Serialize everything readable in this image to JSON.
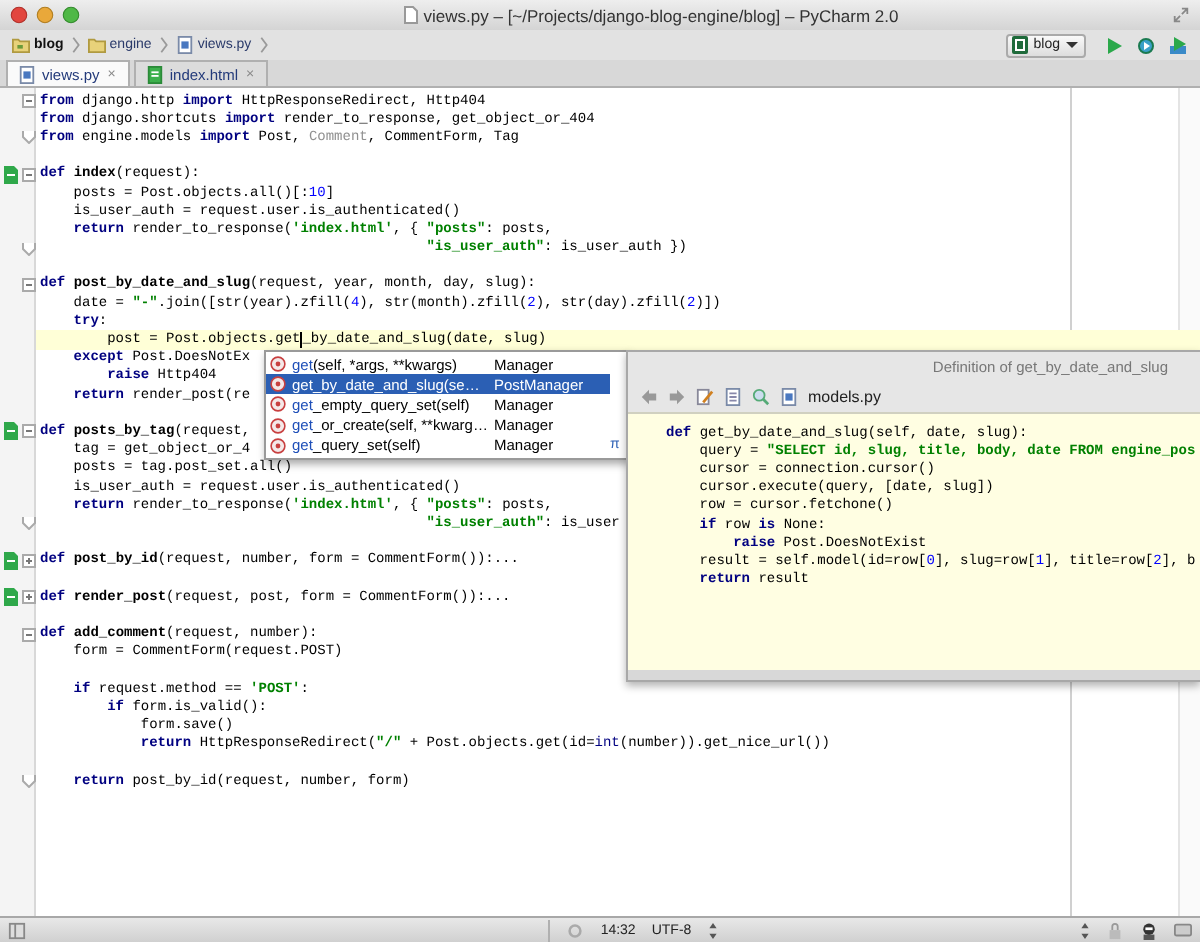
{
  "window": {
    "title": "views.py – [~/Projects/django-blog-engine/blog] – PyCharm 2.0"
  },
  "breadcrumbs": [
    {
      "label": "blog",
      "kind": "project"
    },
    {
      "label": "engine",
      "kind": "folder"
    },
    {
      "label": "views.py",
      "kind": "python"
    }
  ],
  "run_config": {
    "label": "blog"
  },
  "tabs": [
    {
      "label": "views.py",
      "kind": "python",
      "selected": true,
      "close": "×"
    },
    {
      "label": "index.html",
      "kind": "html",
      "selected": false,
      "close": "×"
    }
  ],
  "lines": [
    {
      "markers": [
        {
          "kind": "fold_open"
        }
      ],
      "tokens": [
        {
          "kind": "kw",
          "text": "from"
        },
        {
          "kind": "plain",
          "text": " django.http "
        },
        {
          "kind": "kw",
          "text": "import"
        },
        {
          "kind": "plain",
          "text": " HttpResponseRedirect, Http404"
        }
      ]
    },
    {
      "tokens": [
        {
          "kind": "kw",
          "text": "from"
        },
        {
          "kind": "plain",
          "text": " django.shortcuts "
        },
        {
          "kind": "kw",
          "text": "import"
        },
        {
          "kind": "plain",
          "text": " render_to_response, get_object_or_404"
        }
      ]
    },
    {
      "blank_after": true,
      "markers": [
        {
          "kind": "fold_end"
        }
      ],
      "tokens": [
        {
          "kind": "kw",
          "text": "from"
        },
        {
          "kind": "plain",
          "text": " engine.models "
        },
        {
          "kind": "kw",
          "text": "import"
        },
        {
          "kind": "plain",
          "text": " Post, "
        },
        {
          "kind": "unused",
          "text": "Comment"
        },
        {
          "kind": "plain",
          "text": ", CommentForm, Tag"
        }
      ]
    },
    {
      "markers": [
        {
          "kind": "file"
        },
        {
          "kind": "fold_open"
        }
      ],
      "tokens": [
        {
          "kind": "kw",
          "text": "def "
        },
        {
          "kind": "fn",
          "text": "index"
        },
        {
          "kind": "plain",
          "text": "(request):"
        }
      ]
    },
    {
      "tokens": [
        {
          "kind": "plain",
          "text": "    posts = Post.objects.all()[:"
        },
        {
          "kind": "num",
          "text": "10"
        },
        {
          "kind": "plain",
          "text": "]"
        }
      ]
    },
    {
      "tokens": [
        {
          "kind": "plain",
          "text": "    is_user_auth = request.user.is_authenticated()"
        }
      ]
    },
    {
      "tokens": [
        {
          "kind": "kw",
          "text": "    return"
        },
        {
          "kind": "plain",
          "text": " render_to_response("
        },
        {
          "kind": "str",
          "text": "'index.html'"
        },
        {
          "kind": "plain",
          "text": ", { "
        },
        {
          "kind": "str",
          "text": "\"posts\""
        },
        {
          "kind": "plain",
          "text": ": posts,"
        }
      ]
    },
    {
      "blank_after": true,
      "markers": [
        {
          "kind": "fold_end"
        }
      ],
      "tokens": [
        {
          "kind": "str",
          "text": "                                              \"is_user_auth\""
        },
        {
          "kind": "plain",
          "text": ": is_user_auth })"
        }
      ]
    },
    {
      "markers": [
        {
          "kind": "fold_open"
        }
      ],
      "tokens": [
        {
          "kind": "kw",
          "text": "def "
        },
        {
          "kind": "fn",
          "text": "post_by_date_and_slug"
        },
        {
          "kind": "plain",
          "text": "(request, year, month, day, slug):"
        }
      ]
    },
    {
      "tokens": [
        {
          "kind": "plain",
          "text": "    date = "
        },
        {
          "kind": "str",
          "text": "\"-\""
        },
        {
          "kind": "plain",
          "text": ".join([str(year).zfill("
        },
        {
          "kind": "num",
          "text": "4"
        },
        {
          "kind": "plain",
          "text": "), str(month).zfill("
        },
        {
          "kind": "num",
          "text": "2"
        },
        {
          "kind": "plain",
          "text": "), str(day).zfill("
        },
        {
          "kind": "num",
          "text": "2"
        },
        {
          "kind": "plain",
          "text": ")])"
        }
      ]
    },
    {
      "tokens": [
        {
          "kind": "kw",
          "text": "    try"
        },
        {
          "kind": "plain",
          "text": ":"
        }
      ]
    },
    {
      "current": true,
      "tokens": [
        {
          "kind": "plain",
          "text": "        post = Post.objects.get"
        },
        {
          "kind": "caret"
        },
        {
          "kind": "plain",
          "text": "_by_date_and_slug(date, slug)"
        }
      ]
    },
    {
      "tokens": [
        {
          "kind": "kw",
          "text": "    except"
        },
        {
          "kind": "plain",
          "text": " Post.DoesNotEx"
        }
      ]
    },
    {
      "tokens": [
        {
          "kind": "kw",
          "text": "        raise"
        },
        {
          "kind": "plain",
          "text": " Http404"
        }
      ]
    },
    {
      "blank_after": true,
      "tokens": [
        {
          "kind": "kw",
          "text": "    return"
        },
        {
          "kind": "plain",
          "text": " render_post(re"
        }
      ]
    },
    {
      "markers": [
        {
          "kind": "file"
        },
        {
          "kind": "fold_open"
        }
      ],
      "tokens": [
        {
          "kind": "kw",
          "text": "def "
        },
        {
          "kind": "fn",
          "text": "posts_by_tag"
        },
        {
          "kind": "plain",
          "text": "(request,"
        }
      ]
    },
    {
      "tokens": [
        {
          "kind": "plain",
          "text": "    tag = get_object_or_4"
        }
      ]
    },
    {
      "tokens": [
        {
          "kind": "plain",
          "text": "    posts = tag.post_set.all()"
        }
      ]
    },
    {
      "tokens": [
        {
          "kind": "plain",
          "text": "    is_user_auth = request.user.is_authenticated()"
        }
      ]
    },
    {
      "tokens": [
        {
          "kind": "kw",
          "text": "    return"
        },
        {
          "kind": "plain",
          "text": " render_to_response("
        },
        {
          "kind": "str",
          "text": "'index.html'"
        },
        {
          "kind": "plain",
          "text": ", { "
        },
        {
          "kind": "str",
          "text": "\"posts\""
        },
        {
          "kind": "plain",
          "text": ": posts,"
        }
      ]
    },
    {
      "blank_after": true,
      "markers": [
        {
          "kind": "fold_end"
        }
      ],
      "tokens": [
        {
          "kind": "str",
          "text": "                                              \"is_user_auth\""
        },
        {
          "kind": "plain",
          "text": ": is_user"
        }
      ]
    },
    {
      "blank_after": true,
      "markers": [
        {
          "kind": "file"
        },
        {
          "kind": "fold_closed"
        }
      ],
      "tokens": [
        {
          "kind": "kw",
          "text": "def "
        },
        {
          "kind": "fn",
          "text": "post_by_id"
        },
        {
          "kind": "plain",
          "text": "(request, number, form = CommentForm()):..."
        }
      ]
    },
    {
      "blank_after": true,
      "markers": [
        {
          "kind": "file"
        },
        {
          "kind": "fold_closed"
        }
      ],
      "tokens": [
        {
          "kind": "kw",
          "text": "def "
        },
        {
          "kind": "fn",
          "text": "render_post"
        },
        {
          "kind": "plain",
          "text": "(request, post, form = CommentForm()):..."
        }
      ]
    },
    {
      "markers": [
        {
          "kind": "fold_open"
        }
      ],
      "tokens": [
        {
          "kind": "kw",
          "text": "def "
        },
        {
          "kind": "fn",
          "text": "add_comment"
        },
        {
          "kind": "plain",
          "text": "(request, number):"
        }
      ]
    },
    {
      "blank_after": true,
      "tokens": [
        {
          "kind": "plain",
          "text": "    form = CommentForm(request.POST)"
        }
      ]
    },
    {
      "tokens": [
        {
          "kind": "kw",
          "text": "    if"
        },
        {
          "kind": "plain",
          "text": " request.method == "
        },
        {
          "kind": "str",
          "text": "'POST'"
        },
        {
          "kind": "plain",
          "text": ":"
        }
      ]
    },
    {
      "tokens": [
        {
          "kind": "kw",
          "text": "        if"
        },
        {
          "kind": "plain",
          "text": " form.is_valid():"
        }
      ]
    },
    {
      "tokens": [
        {
          "kind": "plain",
          "text": "            form.save()"
        }
      ]
    },
    {
      "blank_after": true,
      "tokens": [
        {
          "kind": "kw",
          "text": "            return"
        },
        {
          "kind": "plain",
          "text": " HttpResponseRedirect("
        },
        {
          "kind": "str",
          "text": "\"/\""
        },
        {
          "kind": "plain",
          "text": " + Post.objects.get(id="
        },
        {
          "kind": "builtin",
          "text": "int"
        },
        {
          "kind": "plain",
          "text": "(number)).get_nice_url())"
        }
      ]
    },
    {
      "markers": [
        {
          "kind": "fold_end"
        }
      ],
      "tokens": [
        {
          "kind": "kw",
          "text": "    return"
        },
        {
          "kind": "plain",
          "text": " post_by_id(request, number, form)"
        }
      ]
    }
  ],
  "completion": {
    "hint": "π",
    "items": [
      {
        "match": "get",
        "params": "(self, *args, **kwargs)",
        "type": "Manager",
        "selected": false
      },
      {
        "match": "get",
        "rest": "_by_date_and_slug",
        "params": "(se…",
        "type": "PostManager",
        "selected": true
      },
      {
        "match": "get",
        "rest": "_empty_query_set",
        "params": "(self)",
        "type": "Manager",
        "selected": false
      },
      {
        "match": "get",
        "rest": "_or_create",
        "params": "(self, **kwarg…",
        "type": "Manager",
        "selected": false
      },
      {
        "match": "get",
        "rest": "_query_set",
        "params": "(self)",
        "type": "Manager",
        "selected": false
      }
    ]
  },
  "definition": {
    "title": "Definition of get_by_date_and_slug",
    "file": "models.py",
    "lines": [
      {
        "tokens": [
          {
            "kind": "kw",
            "text": "def "
          },
          {
            "kind": "plain",
            "text": "get_by_date_and_slug(self, date, slug):"
          }
        ]
      },
      {
        "tokens": [
          {
            "kind": "plain",
            "text": "    query = "
          },
          {
            "kind": "str",
            "text": "\"SELECT id, slug, title, body, date FROM engine_pos"
          }
        ]
      },
      {
        "tokens": [
          {
            "kind": "plain",
            "text": "    cursor = connection.cursor()"
          }
        ]
      },
      {
        "tokens": [
          {
            "kind": "plain",
            "text": "    cursor.execute(query, [date, slug])"
          }
        ]
      },
      {
        "tokens": [
          {
            "kind": "plain",
            "text": "    row = cursor.fetchone()"
          }
        ]
      },
      {
        "tokens": [
          {
            "kind": "kw",
            "text": "    if"
          },
          {
            "kind": "plain",
            "text": " row "
          },
          {
            "kind": "kw",
            "text": "is"
          },
          {
            "kind": "plain",
            "text": " None:"
          }
        ]
      },
      {
        "tokens": [
          {
            "kind": "kw",
            "text": "        raise"
          },
          {
            "kind": "plain",
            "text": " Post.DoesNotExist"
          }
        ]
      },
      {
        "tokens": [
          {
            "kind": "plain",
            "text": "    result = self.model(id=row["
          },
          {
            "kind": "num",
            "text": "0"
          },
          {
            "kind": "plain",
            "text": "], slug=row["
          },
          {
            "kind": "num",
            "text": "1"
          },
          {
            "kind": "plain",
            "text": "], title=row["
          },
          {
            "kind": "num",
            "text": "2"
          },
          {
            "kind": "plain",
            "text": "], b"
          }
        ]
      },
      {
        "tokens": [
          {
            "kind": "kw",
            "text": "    return"
          },
          {
            "kind": "plain",
            "text": " result"
          }
        ]
      }
    ]
  },
  "status_bar": {
    "position": "14:32",
    "encoding": "UTF-8"
  }
}
